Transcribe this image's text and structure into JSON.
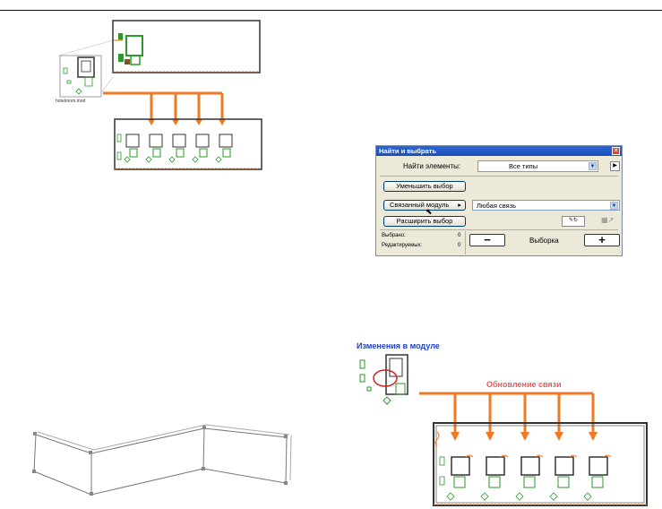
{
  "module_file_label": "hotelroom.mod",
  "find_select": {
    "title": "Найти и выбрать",
    "find_elements_label": "Найти элементы:",
    "type_value": "Все типы",
    "reduce_button": "Уменьшить выбор",
    "linked_module_button": "Связанный модуль",
    "link_value": "Любая связь",
    "expand_button": "Расширить выбор",
    "selected_label": "Выбрано:",
    "selected_count": "0",
    "editable_label": "Редактируемых:",
    "editable_count": "0",
    "minus_label": "−",
    "selection_label": "Выборка",
    "plus_label": "+"
  },
  "captions": {
    "module_changes": "Изменения в модуле",
    "link_update": "Обновление связи"
  },
  "colors": {
    "arrow": "#f07a24",
    "plan_green": "#2a9a2a",
    "panel_bg": "#ece9d8",
    "title_bar": "#1f57c8",
    "highlight_circle": "#d62020"
  }
}
